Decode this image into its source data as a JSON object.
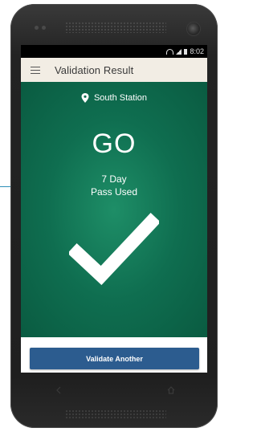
{
  "status_bar": {
    "time": "8:02",
    "icons": [
      "wifi-icon",
      "signal-icon",
      "battery-icon"
    ]
  },
  "app_bar": {
    "menu_icon": "menu-icon",
    "title": "Validation Result",
    "background": "#f2ede4"
  },
  "result": {
    "location_icon": "location-pin-icon",
    "location": "South Station",
    "status": "GO",
    "pass_line_1": "7 Day",
    "pass_line_2": "Pass Used",
    "result_icon": "checkmark-icon",
    "background": "#0f6e50"
  },
  "actions": {
    "validate_label": "Validate Another",
    "button_color": "#2c5c8f"
  },
  "device_nav": {
    "back_icon": "back-icon",
    "home_icon": "home-icon"
  }
}
